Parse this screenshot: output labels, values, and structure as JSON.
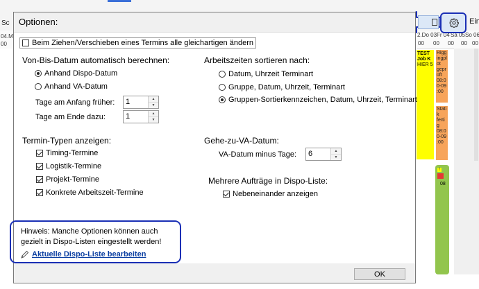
{
  "background": {
    "toolbar_left_text": "Sc",
    "einh_label": "Einh",
    "timeline_left": [
      "04.M",
      "00"
    ],
    "timeline_dates": [
      "2.Do 03",
      "Fr 04",
      "Sa 05",
      "So 06"
    ],
    "timeline_hours": [
      "00",
      "00",
      "00",
      "00",
      "00"
    ],
    "yellow_event_lines": [
      "TEST",
      "Job K",
      "HIER  5"
    ],
    "orange_event_1": "Rigg\ningpl\not\ngepr\nüft\n08:0\n0-09\n:00",
    "orange_event_2": "Stati\nk\nferti\ng\n08:0\n0-09\n:00",
    "green_event_flag": "!",
    "green_event_label": "08"
  },
  "dialog": {
    "title": "Optionen:",
    "close_label": "×",
    "top_option": {
      "label": "Beim Ziehen/Verschieben eines Termins alle gleichartigen ändern",
      "checked": false
    },
    "vonbis": {
      "heading": "Von-Bis-Datum automatisch berechnen:",
      "options": [
        {
          "label": "Anhand Dispo-Datum",
          "selected": true
        },
        {
          "label": "Anhand VA-Datum",
          "selected": false
        }
      ],
      "tage_anfang_label": "Tage am Anfang früher:",
      "tage_anfang_value": "1",
      "tage_ende_label": "Tage am Ende dazu:",
      "tage_ende_value": "1"
    },
    "termin_typen": {
      "heading": "Termin-Typen anzeigen:",
      "items": [
        {
          "label": "Timing-Termine",
          "checked": true
        },
        {
          "label": "Logistik-Termine",
          "checked": true
        },
        {
          "label": "Projekt-Termine",
          "checked": true
        },
        {
          "label": "Konkrete Arbeitszeit-Termine",
          "checked": true
        }
      ]
    },
    "arbeitszeiten": {
      "heading": "Arbeitszeiten sortieren nach:",
      "options": [
        {
          "label": "Datum, Uhrzeit Terminart",
          "selected": false
        },
        {
          "label": "Gruppe, Datum, Uhrzeit, Terminart",
          "selected": false
        },
        {
          "label": "Gruppen-Sortierkennzeichen, Datum, Uhrzeit, Terminart",
          "selected": true
        }
      ]
    },
    "gehe_zu": {
      "heading": "Gehe-zu-VA-Datum:",
      "label": "VA-Datum minus Tage:",
      "value": "6"
    },
    "mehrere": {
      "heading": "Mehrere Aufträge in Dispo-Liste:",
      "option": {
        "label": "Nebeneinander anzeigen",
        "checked": true
      }
    },
    "hint": {
      "line1": "Hinweis: Manche Optionen können auch",
      "line2": "gezielt in Dispo-Listen eingestellt werden!",
      "link": "Aktuelle Dispo-Liste bearbeiten"
    },
    "ok_label": "OK"
  },
  "colors": {
    "annotation_blue": "#1a2fb5",
    "link_blue": "#0a3ea1",
    "event_yellow": "#ffff00",
    "event_orange": "#f7a45a",
    "event_green": "#92c54d"
  }
}
